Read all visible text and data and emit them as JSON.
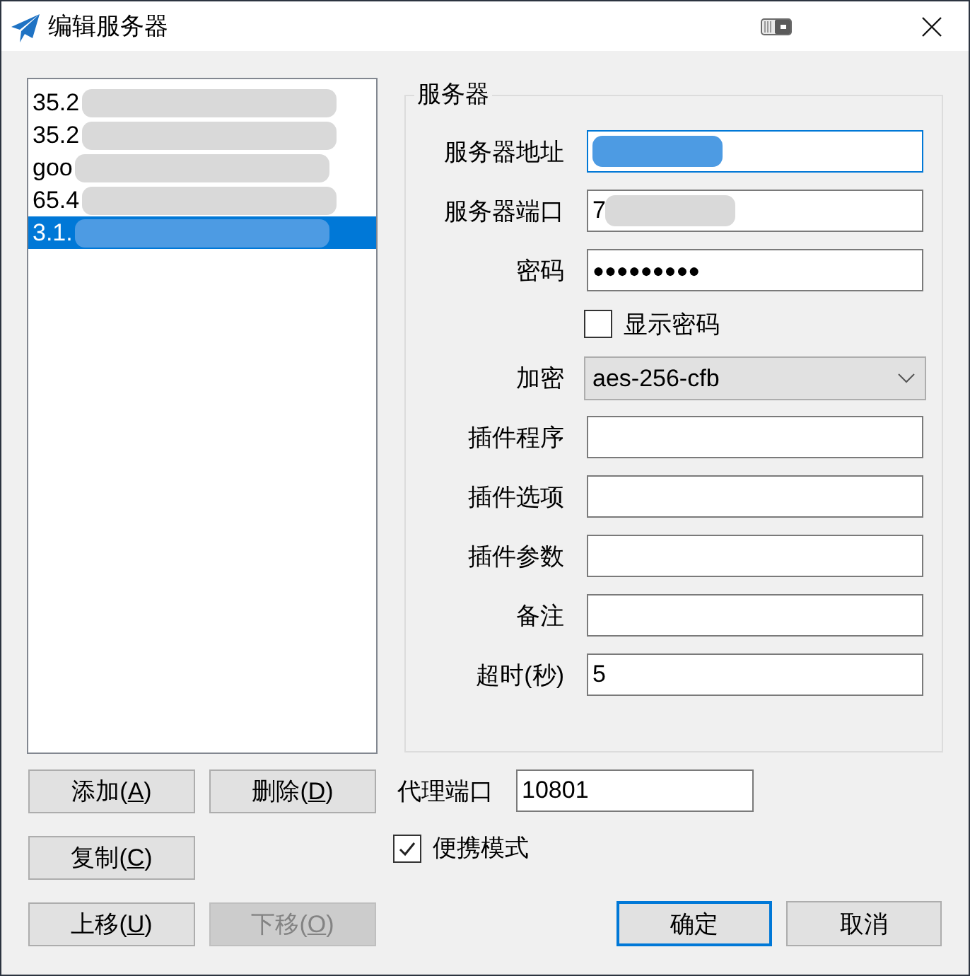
{
  "window": {
    "title": "编辑服务器"
  },
  "server_list": {
    "items": [
      {
        "label": "35.2",
        "selected": false,
        "redacted": true
      },
      {
        "label": "35.2",
        "selected": false,
        "redacted": true
      },
      {
        "label": "goo",
        "selected": false,
        "redacted": true
      },
      {
        "label": "65.4",
        "selected": false,
        "redacted": true
      },
      {
        "label": "3.1.",
        "selected": true,
        "redacted": true
      }
    ]
  },
  "server_group": {
    "title": "服务器",
    "fields": [
      {
        "kind": "text",
        "label": "服务器地址",
        "focused": true,
        "redacted": true
      },
      {
        "kind": "text",
        "label": "服务器端口",
        "value": "7",
        "focused": false,
        "redacted": true
      },
      {
        "kind": "password",
        "label": "密码",
        "value": "●●●●●●●●●",
        "focused": false
      },
      {
        "kind": "checkbox",
        "label": "显示密码",
        "checked": false
      },
      {
        "kind": "select",
        "label": "加密",
        "value": "aes-256-cfb"
      },
      {
        "kind": "text",
        "label": "插件程序",
        "focused": false,
        "redacted": false
      },
      {
        "kind": "text",
        "label": "插件选项",
        "focused": false,
        "redacted": false
      },
      {
        "kind": "text",
        "label": "插件参数",
        "focused": false,
        "redacted": false
      },
      {
        "kind": "text",
        "label": "备注",
        "focused": false,
        "redacted": false
      },
      {
        "kind": "text",
        "label": "超时(秒)",
        "value": "5",
        "focused": false,
        "redacted": false
      }
    ]
  },
  "list_button_rows": [
    [
      {
        "before": "添加(",
        "key": "A",
        "after": ")",
        "disabled": false
      },
      {
        "before": "删除(",
        "key": "D",
        "after": ")",
        "disabled": false
      }
    ],
    [
      {
        "before": "复制(",
        "key": "C",
        "after": ")",
        "disabled": false
      }
    ],
    [
      {
        "before": "上移(",
        "key": "U",
        "after": ")",
        "disabled": false
      },
      {
        "before": "下移(",
        "key": "O",
        "after": ")",
        "disabled": true
      }
    ]
  ],
  "proxy_port": {
    "label": "代理端口",
    "value": "10801"
  },
  "portable_mode": {
    "label": "便携模式",
    "checked": true
  },
  "dialog_buttons": [
    {
      "label": "确定",
      "default": true
    },
    {
      "label": "取消",
      "default": false
    }
  ]
}
